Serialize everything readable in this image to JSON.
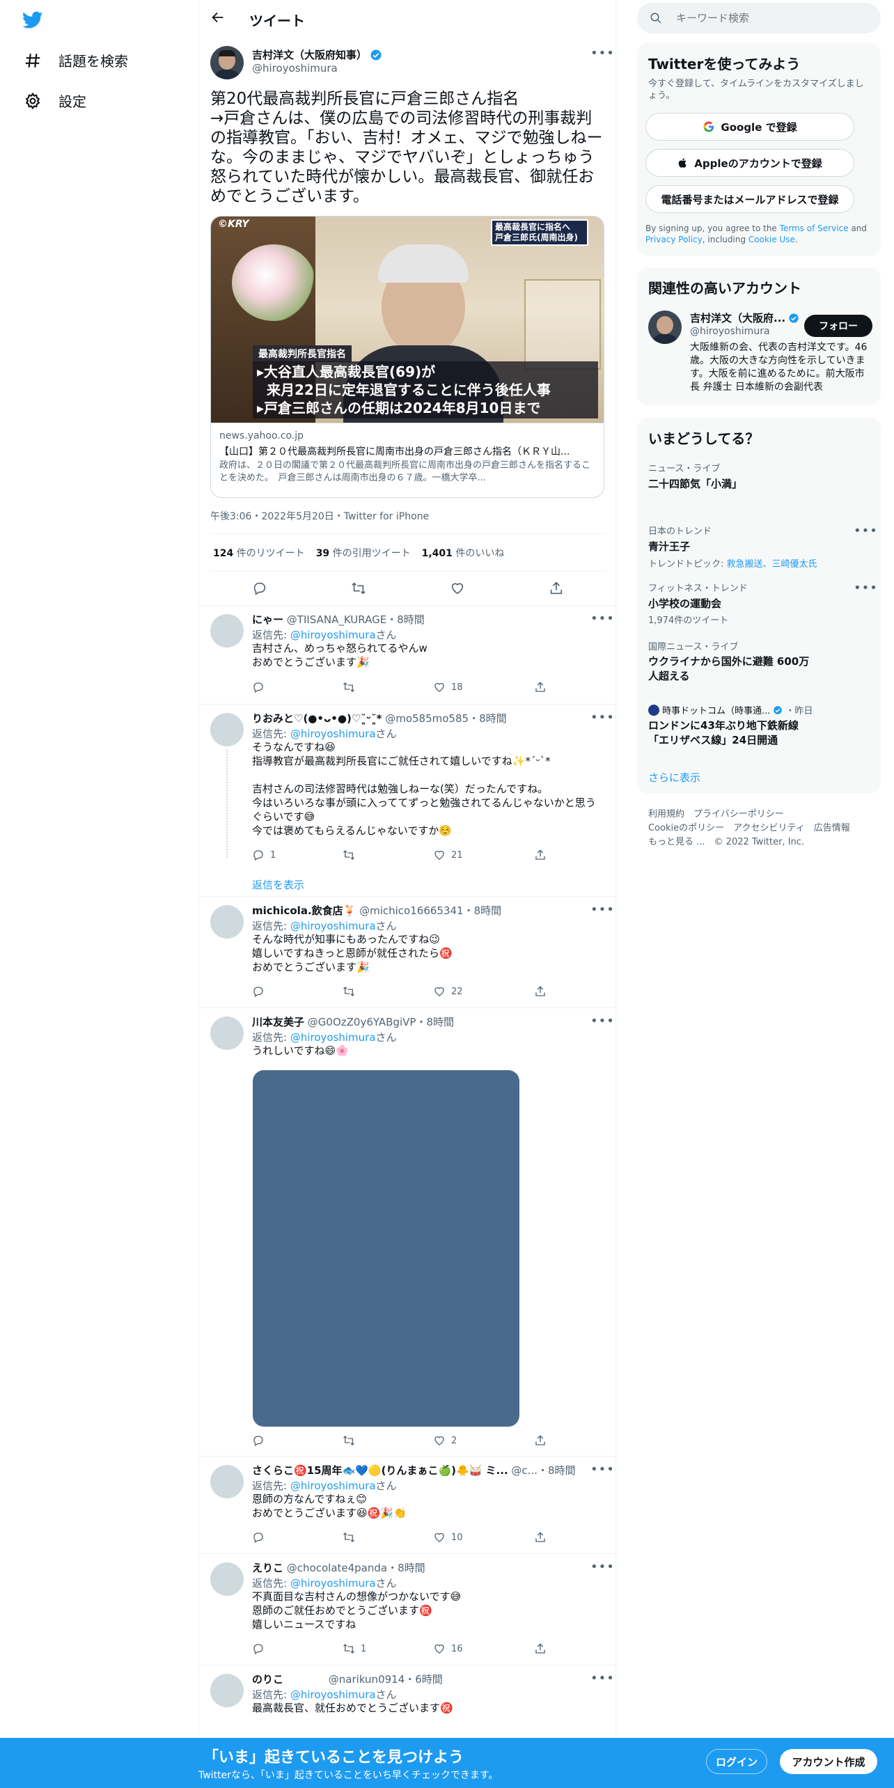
{
  "nav": {
    "explore": "話題を検索",
    "settings": "設定"
  },
  "header": {
    "title": "ツイート"
  },
  "tweet": {
    "author": "吉村洋文（大阪府知事）",
    "handle": "@hiroyoshimura",
    "text": "第20代最高裁判所長官に戸倉三郎さん指名\n→戸倉さんは、僕の広島での司法修習時代の刑事裁判の指導教官。「おい、吉村！オメェ、マジで勉強しねーな。今のままじゃ、マジでヤバいぞ」としょっちゅう怒られていた時代が懐かしい。最高裁長官、御就任おめでとうございます。",
    "media": {
      "corner_logo": "©KRY",
      "badge_line1": "最高裁長官に指名へ",
      "badge_line2": "戸倉三郎氏(周南出身)",
      "caption_title": "最高裁判所長官指名",
      "caption_line1": "▸大谷直人最高裁長官(69)が",
      "caption_line2": "来月22日に定年退官することに伴う後任人事",
      "caption_line3": "▸戸倉三郎さんの任期は2024年8月10日まで"
    },
    "card": {
      "domain": "news.yahoo.co.jp",
      "title": "【山口】第２０代最高裁判所長官に周南市出身の戸倉三郎さん指名（ＫＲＹ山...",
      "desc": "政府は、２０日の閣議で第２０代最高裁判所長官に周南市出身の戸倉三郎さんを指名することを決めた。　戸倉三郎さんは周南市出身の６７歳。一橋大学卒..."
    },
    "timestamp": "午後3:06・2022年5月20日・Twitter for iPhone",
    "stats": {
      "retweets_num": "124",
      "retweets_label": "件のリツイート",
      "quotes_num": "39",
      "quotes_label": "件の引用ツイート",
      "likes_num": "1,401",
      "likes_label": "件のいいね"
    }
  },
  "replies": [
    {
      "name": "にゃー",
      "handle": "@TIISANA_KURAGE",
      "time": "・8時間",
      "reply_to_prefix": "返信先: ",
      "reply_to": "@hiroyoshimura",
      "reply_to_suffix": "さん",
      "text": "吉村さん、めっちゃ怒られてるやんw\nおめでとうございます🎉",
      "replies": "",
      "retweets": "",
      "likes": "18"
    },
    {
      "name": "りおみと♡(●•ᴗ•●)♡˘͈ᵕ˘͈*",
      "handle": "@mo585mo585",
      "time": "・8時間",
      "reply_to_prefix": "返信先: ",
      "reply_to": "@hiroyoshimura",
      "reply_to_suffix": "さん",
      "text": "そうなんですね😆\n指導教官が最高裁判所長官にご就任されて嬉しいですね✨*ˊᵕˋ*\n\n吉村さんの司法修習時代は勉強しねーな(笑）だったんですね。\n今はいろいろな事が頭に入っててずっと勉強されてるんじゃないかと思うぐらいです😅\n今では褒めてもらえるんじゃないですか☺️",
      "replies": "1",
      "retweets": "",
      "likes": "21",
      "show_replies": "返信を表示"
    },
    {
      "name": "michicola.飲食店🍹",
      "handle": "@michico16665341",
      "time": "・8時間",
      "reply_to_prefix": "返信先: ",
      "reply_to": "@hiroyoshimura",
      "reply_to_suffix": "さん",
      "text": "そんな時代が知事にもあったんですね😉\n嬉しいですねきっと恩師が就任されたら㊗️\nおめでとうございます🎉",
      "replies": "",
      "retweets": "",
      "likes": "22"
    },
    {
      "name": "川本友美子",
      "handle": "@G0OzZ0y6YABgiVP",
      "time": "・8時間",
      "reply_to_prefix": "返信先: ",
      "reply_to": "@hiroyoshimura",
      "reply_to_suffix": "さん",
      "text": "うれしいですね😄🌸",
      "replies": "",
      "retweets": "",
      "likes": "2"
    },
    {
      "name": "さくらこ㊗️15周年🐟💙🟡(りんまぁこ🍏)🐥🥁 ミ...",
      "handle": "@c...",
      "time": "・8時間",
      "reply_to_prefix": "返信先: ",
      "reply_to": "@hiroyoshimura",
      "reply_to_suffix": "さん",
      "text": "恩師の方なんですねぇ😊\nおめでとうございます😆㊗️🎉👏",
      "replies": "",
      "retweets": "",
      "likes": "10"
    },
    {
      "name": "えりこ",
      "handle": "@chocolate4panda",
      "time": "・8時間",
      "reply_to_prefix": "返信先: ",
      "reply_to": "@hiroyoshimura",
      "reply_to_suffix": "さん",
      "text": "不真面目な吉村さんの想像がつかないです😅\n恩師のご就任おめでとうございます㊗️\n嬉しいニュースですね",
      "replies": "",
      "retweets": "1",
      "likes": "16"
    },
    {
      "name": "のりこ",
      "handle": "@narikun0914",
      "time": "・6時間",
      "reply_to_prefix": "返信先: ",
      "reply_to": "@hiroyoshimura",
      "reply_to_suffix": "さん",
      "text": "最高裁長官、就任おめでとうございます㊗️"
    }
  ],
  "sidebar": {
    "search_placeholder": "キーワード検索",
    "signup": {
      "title": "Twitterを使ってみよう",
      "subtitle": "今すぐ登録して、タイムラインをカスタマイズしましょう。",
      "google": "Google で登録",
      "apple": "Appleのアカウントで登録",
      "phone": "電話番号またはメールアドレスで登録",
      "terms_prefix": "By signing up, you agree to the ",
      "terms": "Terms of Service",
      "and": " and ",
      "privacy": "Privacy Policy",
      "including": ", including ",
      "cookie": "Cookie Use",
      "period": "."
    },
    "related": {
      "title": "関連性の高いアカウント",
      "name": "吉村洋文（大阪府...",
      "handle": "@hiroyoshimura",
      "follow": "フォロー",
      "bio": "大阪維新の会、代表の吉村洋文です。46歳。大阪の大きな方向性を示していきます。大阪を前に進めるために。前大阪市長 弁護士 日本維新の会副代表"
    },
    "trends": {
      "title": "いまどうしてる？",
      "items": [
        {
          "meta": "ニュース・ライブ",
          "title": "二十四節気「小満」"
        },
        {
          "meta": "日本のトレンド",
          "title": "青汁王子",
          "topics_prefix": "トレンドトピック: ",
          "topics": "救急搬送、三崎優太氏"
        },
        {
          "meta": "フィットネス・トレンド",
          "title": "小学校の運動会",
          "count": "1,974件のツイート"
        },
        {
          "meta": "国際ニュース・ライブ",
          "title": "ウクライナから国外に避難 600万人超える"
        },
        {
          "meta_name": "時事ドットコム（時事通...",
          "meta_time": "・昨日",
          "title": "ロンドンに43年ぶり地下鉄新線「エリザベス線」24日開通"
        }
      ],
      "show_more": "さらに表示"
    },
    "footer": {
      "terms": "利用規約",
      "privacy": "プライバシーポリシー",
      "cookie": "Cookieのポリシー",
      "access": "アクセシビリティ",
      "ads": "広告情報",
      "more": "もっと見る ...",
      "copy": "© 2022 Twitter, Inc."
    }
  },
  "bottom_bar": {
    "headline": "「いま」起きていることを見つけよう",
    "sub": "Twitterなら、「いま」起きていることをいち早くチェックできます。",
    "login": "ログイン",
    "signup": "アカウント作成"
  },
  "colors": {
    "brand": "#1d9bf0",
    "bar": "#1d9bf0",
    "text": "#0f1419",
    "muted": "#536471"
  }
}
